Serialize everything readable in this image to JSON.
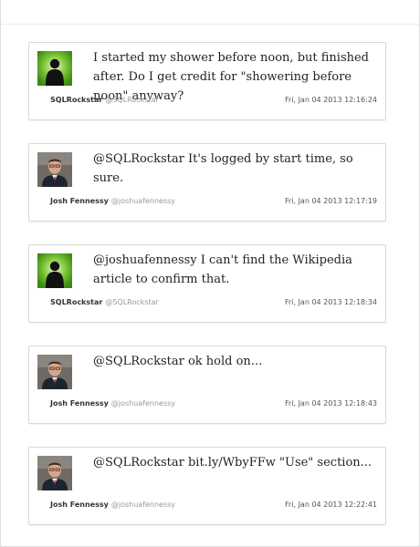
{
  "tweets": [
    {
      "avatar": "sqlrockstar-avatar",
      "text": "I started my shower before noon, but finished after. Do I get credit for \"showering before noon\" anyway?",
      "display_name": "SQLRockstar",
      "handle": "@SQLRockstar",
      "timestamp": "Fri, Jan 04 2013 12:16:24"
    },
    {
      "avatar": "joshuafennessy-avatar",
      "text": "@SQLRockstar It's logged by start time, so sure.",
      "display_name": "Josh Fennessy",
      "handle": "@joshuafennessy",
      "timestamp": "Fri, Jan 04 2013 12:17:19"
    },
    {
      "avatar": "sqlrockstar-avatar",
      "text": "@joshuafennessy I can't find the Wikipedia article to confirm that.",
      "display_name": "SQLRockstar",
      "handle": "@SQLRockstar",
      "timestamp": "Fri, Jan 04 2013 12:18:34"
    },
    {
      "avatar": "joshuafennessy-avatar",
      "text": "@SQLRockstar ok hold on...",
      "display_name": "Josh Fennessy",
      "handle": "@joshuafennessy",
      "timestamp": "Fri, Jan 04 2013 12:18:43"
    },
    {
      "avatar": "joshuafennessy-avatar",
      "text": "@SQLRockstar bit.ly/WbyFFw \"Use\" section...",
      "display_name": "Josh Fennessy",
      "handle": "@joshuafennessy",
      "timestamp": "Fri, Jan 04 2013 12:22:41"
    }
  ],
  "colors": {
    "card_border": "#d9d9d9",
    "name": "#333333",
    "handle": "#999999",
    "timestamp": "#555555",
    "sqlrockstar_avatar_green": "#4fa31c",
    "joshuafennessy_suit": "#1c2430"
  }
}
